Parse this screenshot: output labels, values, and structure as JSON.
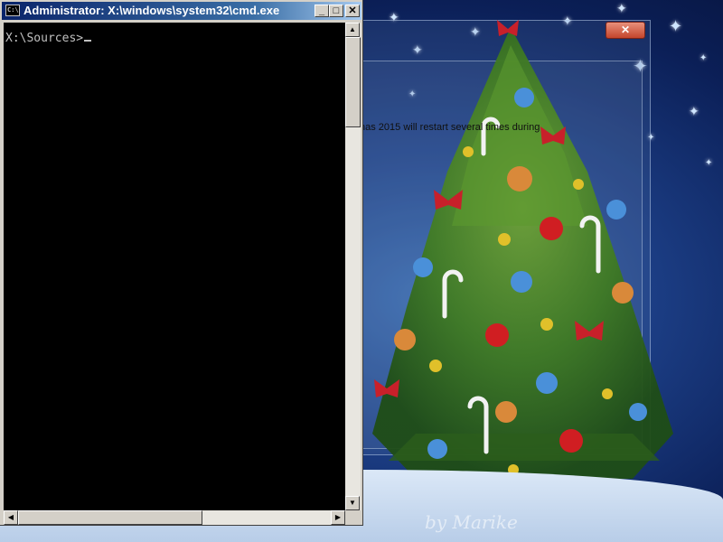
{
  "cmd_window": {
    "title": "Administrator: X:\\windows\\system32\\cmd.exe",
    "icon_text": "C:\\",
    "minimize_symbol": "_",
    "maximize_symbol": "□",
    "close_symbol": "✕",
    "prompt_text": "X:\\Sources>"
  },
  "background_window": {
    "close_symbol": "✕",
    "body_text": "nas 2015 will restart several times during"
  },
  "wallpaper": {
    "signature_text": "by Marike"
  },
  "colors": {
    "console_bg": "#000000",
    "console_fg": "#c0c0c0",
    "titlebar_start": "#0a246a",
    "titlebar_end": "#a6caf0"
  }
}
